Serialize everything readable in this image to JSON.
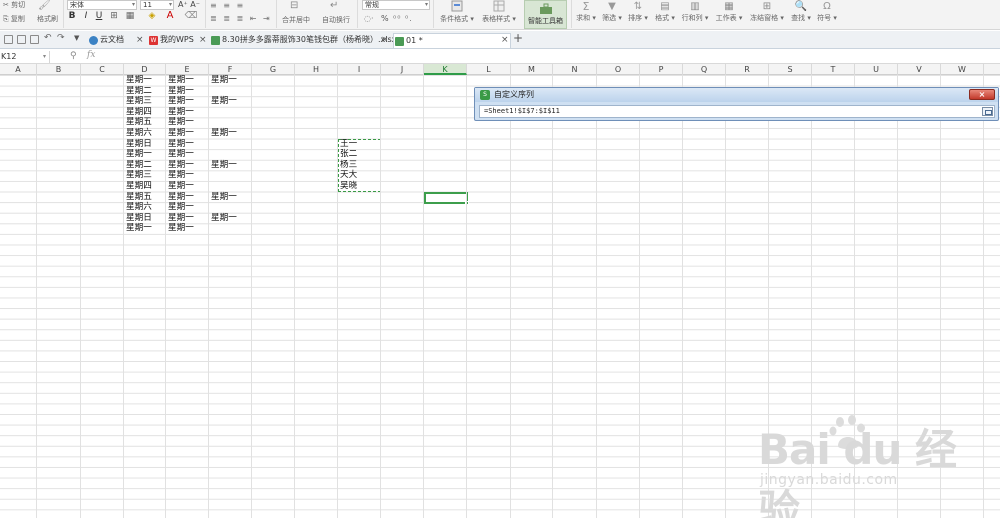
{
  "ribbon": {
    "clipboard": {
      "cut": "剪切",
      "copy": "复制",
      "format_painter": "格式刷"
    },
    "font": {
      "name": "宋体",
      "size": "11"
    },
    "font_buttons": {
      "bold": "B",
      "italic": "I",
      "underline": "U"
    },
    "align": {
      "merge_center": "合并居中",
      "auto_wrap": "自动换行"
    },
    "number_format": {
      "value": "常规",
      "percent": "%"
    },
    "styles": {
      "conditional_format": "条件格式",
      "table_style": "表格样式"
    },
    "smart_toolbox": "智能工具箱",
    "editing": {
      "sum": "求和",
      "filter": "筛选",
      "sort": "排序",
      "format": "格式",
      "row_col": "行和列",
      "worksheet": "工作表",
      "freeze": "冻结窗格",
      "find": "查找",
      "symbol": "符号"
    }
  },
  "tabs": {
    "cloud": "云文档",
    "my_wps": "我的WPS",
    "doc1": "8.30拼多多露蒂服饰30笔钱包群（杨希晓）.xlsx",
    "doc2": "01 *",
    "new": "+",
    "close": "×"
  },
  "formula_bar": {
    "name_box": "K12",
    "fx": "fx",
    "zoom_icon": "search-icon"
  },
  "columns": [
    "A",
    "B",
    "C",
    "D",
    "E",
    "F",
    "G",
    "H",
    "I",
    "J",
    "K",
    "L",
    "M",
    "N",
    "O",
    "P",
    "Q",
    "R",
    "S",
    "T",
    "U",
    "V",
    "W"
  ],
  "active_column": "K",
  "sheet": {
    "col_d": [
      "星期一",
      "星期二",
      "星期三",
      "星期四",
      "星期五",
      "星期六",
      "星期日",
      "星期一",
      "星期二",
      "星期三",
      "星期四",
      "星期五",
      "星期六",
      "星期日",
      "星期一"
    ],
    "col_e": [
      "星期一",
      "星期一",
      "星期一",
      "星期一",
      "星期一",
      "星期一",
      "星期一",
      "星期一",
      "星期一",
      "星期一",
      "星期一",
      "星期一",
      "星期一",
      "星期一",
      "星期一"
    ],
    "col_f": [
      "星期一",
      "",
      "星期一",
      "",
      "",
      "星期一",
      "",
      "",
      "星期一",
      "",
      "",
      "星期一",
      "",
      "星期一",
      ""
    ],
    "col_i": [
      "王一",
      "张二",
      "杨三",
      "天大",
      "吴晓"
    ]
  },
  "dialog": {
    "title": "自定义序列",
    "formula": "=Sheet1!$I$7:$I$11",
    "close": "×"
  },
  "watermark": {
    "logo": "Bai du 经验",
    "url": "jingyan.baidu.com"
  },
  "colors": {
    "accent_green": "#3d9e4c",
    "dialog_blue": "#6f8fb8",
    "close_red": "#c2392b"
  }
}
